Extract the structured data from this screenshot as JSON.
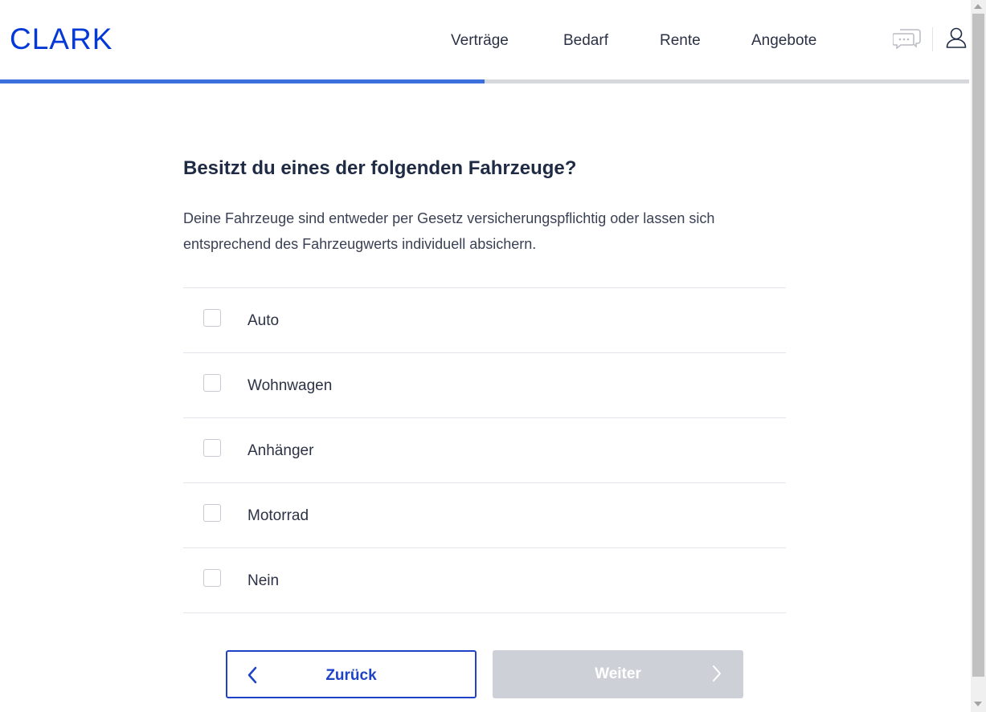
{
  "header": {
    "logo": "CLARK",
    "nav": [
      "Verträge",
      "Bedarf",
      "Rente",
      "Angebote"
    ],
    "icons": {
      "chat": "chat-bubbles-icon",
      "user": "user-icon"
    }
  },
  "progress": {
    "value": 0.5
  },
  "question": {
    "title": "Besitzt du eines der folgenden Fahrzeuge?",
    "description": "Deine Fahrzeuge sind entweder per Gesetz versicherungspflichtig oder lassen sich entsprechend des Fahrzeugwerts individuell absichern.",
    "options": [
      {
        "label": "Auto",
        "checked": false
      },
      {
        "label": "Wohnwagen",
        "checked": false
      },
      {
        "label": "Anhänger",
        "checked": false
      },
      {
        "label": "Motorrad",
        "checked": false
      },
      {
        "label": "Nein",
        "checked": false
      }
    ]
  },
  "buttons": {
    "back": "Zurück",
    "next": "Weiter",
    "next_disabled": true
  },
  "colors": {
    "brand": "#0439d7",
    "progress": "#3b6fdc",
    "button_border": "#1f43c6",
    "disabled": "#cdd1d7"
  }
}
